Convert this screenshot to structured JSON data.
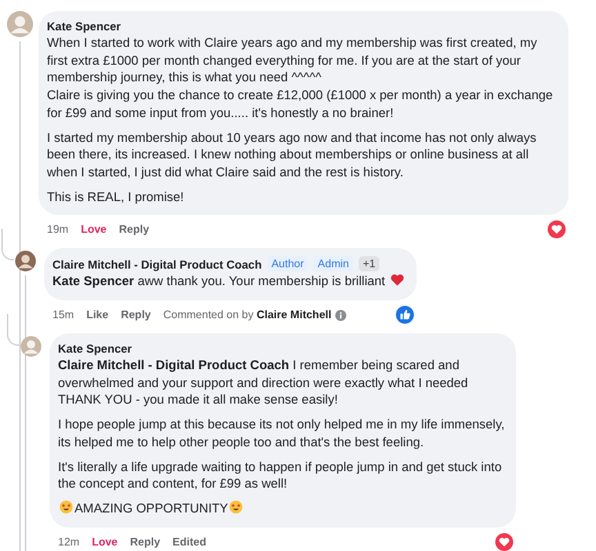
{
  "comments": [
    {
      "author": "Kate Spencer",
      "paragraphs": [
        {
          "text": "When I started to work with Claire years ago and my membership was first created, my first extra £1000 per month changed everything for me. If you are at the start of your membership journey, this is what you need ^^^^^\nClaire is giving you the chance to create £12,000 (£1000 x per month) a year in exchange for £99 and some input from you..... it's honestly a no brainer!"
        },
        {
          "text": "I started my membership about 10 years ago now and that income has not only always been there, its increased. I knew nothing about memberships or online business at all when I started, I just did what Claire said and the rest is history."
        },
        {
          "text": "This is REAL, I promise!"
        }
      ],
      "time": "19m",
      "actions": [
        {
          "label": "Love",
          "active": true
        },
        {
          "label": "Reply",
          "active": false
        }
      ],
      "reaction": {
        "kind": "love"
      },
      "children": [
        {
          "author": "Claire Mitchell - Digital Product Coach",
          "badges": [
            {
              "label": "Author",
              "kind": "role"
            },
            {
              "label": "Admin",
              "kind": "role"
            },
            {
              "label": "+1",
              "kind": "count"
            }
          ],
          "paragraphs": [
            {
              "text": "**Kate Spencer** aww thank you. Your membership is brilliant",
              "trail_icon": {
                "kind": "heart"
              }
            }
          ],
          "time": "15m",
          "actions": [
            {
              "label": "Like",
              "active": false
            },
            {
              "label": "Reply",
              "active": false
            }
          ],
          "note": "Commented on by **Claire Mitchell**",
          "reaction": {
            "kind": "like"
          },
          "children": [
            {
              "author": "Kate Spencer",
              "paragraphs": [
                {
                  "text": "**Claire Mitchell - Digital Product Coach** I remember being scared and overwhelmed and your support and direction were exactly what I needed THANK YOU - you made it all make sense easily!"
                },
                {
                  "text": "I hope people jump at this because its not only helped me in my life immensely, its helped me to help other people too and that's the best feeling."
                },
                {
                  "text": "It's literally a life upgrade waiting to happen if people jump in and get stuck into the concept and content, for £99 as well!"
                },
                {
                  "text": "AMAZING OPPORTUNITY",
                  "lead_icon": {
                    "kind": "star-struck"
                  },
                  "trail_icon": {
                    "kind": "star-struck"
                  }
                }
              ],
              "time": "12m",
              "actions": [
                {
                  "label": "Love",
                  "active": true
                },
                {
                  "label": "Reply",
                  "active": false
                }
              ],
              "edited_label": "Edited",
              "reaction": {
                "kind": "love"
              }
            }
          ]
        }
      ]
    }
  ]
}
